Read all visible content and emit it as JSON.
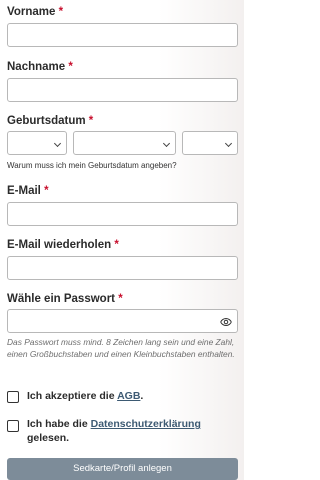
{
  "form": {
    "required_mark": "*",
    "vorname": {
      "label": "Vorname",
      "value": ""
    },
    "nachname": {
      "label": "Nachname",
      "value": ""
    },
    "geburtsdatum": {
      "label": "Geburtsdatum",
      "day": "",
      "month": "",
      "year": "",
      "hint_link": "Warum muss ich mein Geburtsdatum angeben?"
    },
    "email": {
      "label": "E-Mail",
      "value": ""
    },
    "email_repeat": {
      "label": "E-Mail wiederholen",
      "value": ""
    },
    "password": {
      "label": "Wähle ein Passwort",
      "value": "",
      "hint": "Das Passwort muss mind. 8 Zeichen lang sein und eine Zahl, einen Großbuchstaben und einen Kleinbuchstaben enthalten."
    },
    "agb": {
      "prefix": "Ich akzeptiere die ",
      "link": "AGB",
      "suffix": ".",
      "checked": false
    },
    "privacy": {
      "prefix": "Ich habe die ",
      "link": "Datenschutzerklärung",
      "suffix": " gelesen.",
      "checked": false
    },
    "submit_label": "Sedkarte/Profil anlegen"
  },
  "colors": {
    "required": "#c8102e",
    "button": "#7d8c99",
    "link": "#3d5a73"
  }
}
